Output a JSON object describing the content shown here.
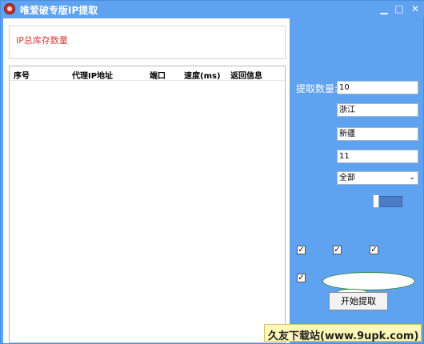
{
  "window": {
    "title": "唯爱破专版IP提取",
    "min": "▁",
    "max": "□",
    "close": "✕"
  },
  "stock": {
    "label": "IP总库存数量"
  },
  "list": {
    "columns": [
      "序号",
      "代理IP地址",
      "端口",
      "速度(ms)",
      "返回信息"
    ]
  },
  "controls": {
    "count_label": "提取数量:",
    "count_value": "10",
    "province": "浙江",
    "region": "新疆",
    "number": "11",
    "select_value": "全部",
    "select_arrow": "⌄",
    "check": "✓",
    "start_label": "开始提取"
  },
  "watermark": {
    "text": "久友下载站(www.9upk.com)"
  }
}
